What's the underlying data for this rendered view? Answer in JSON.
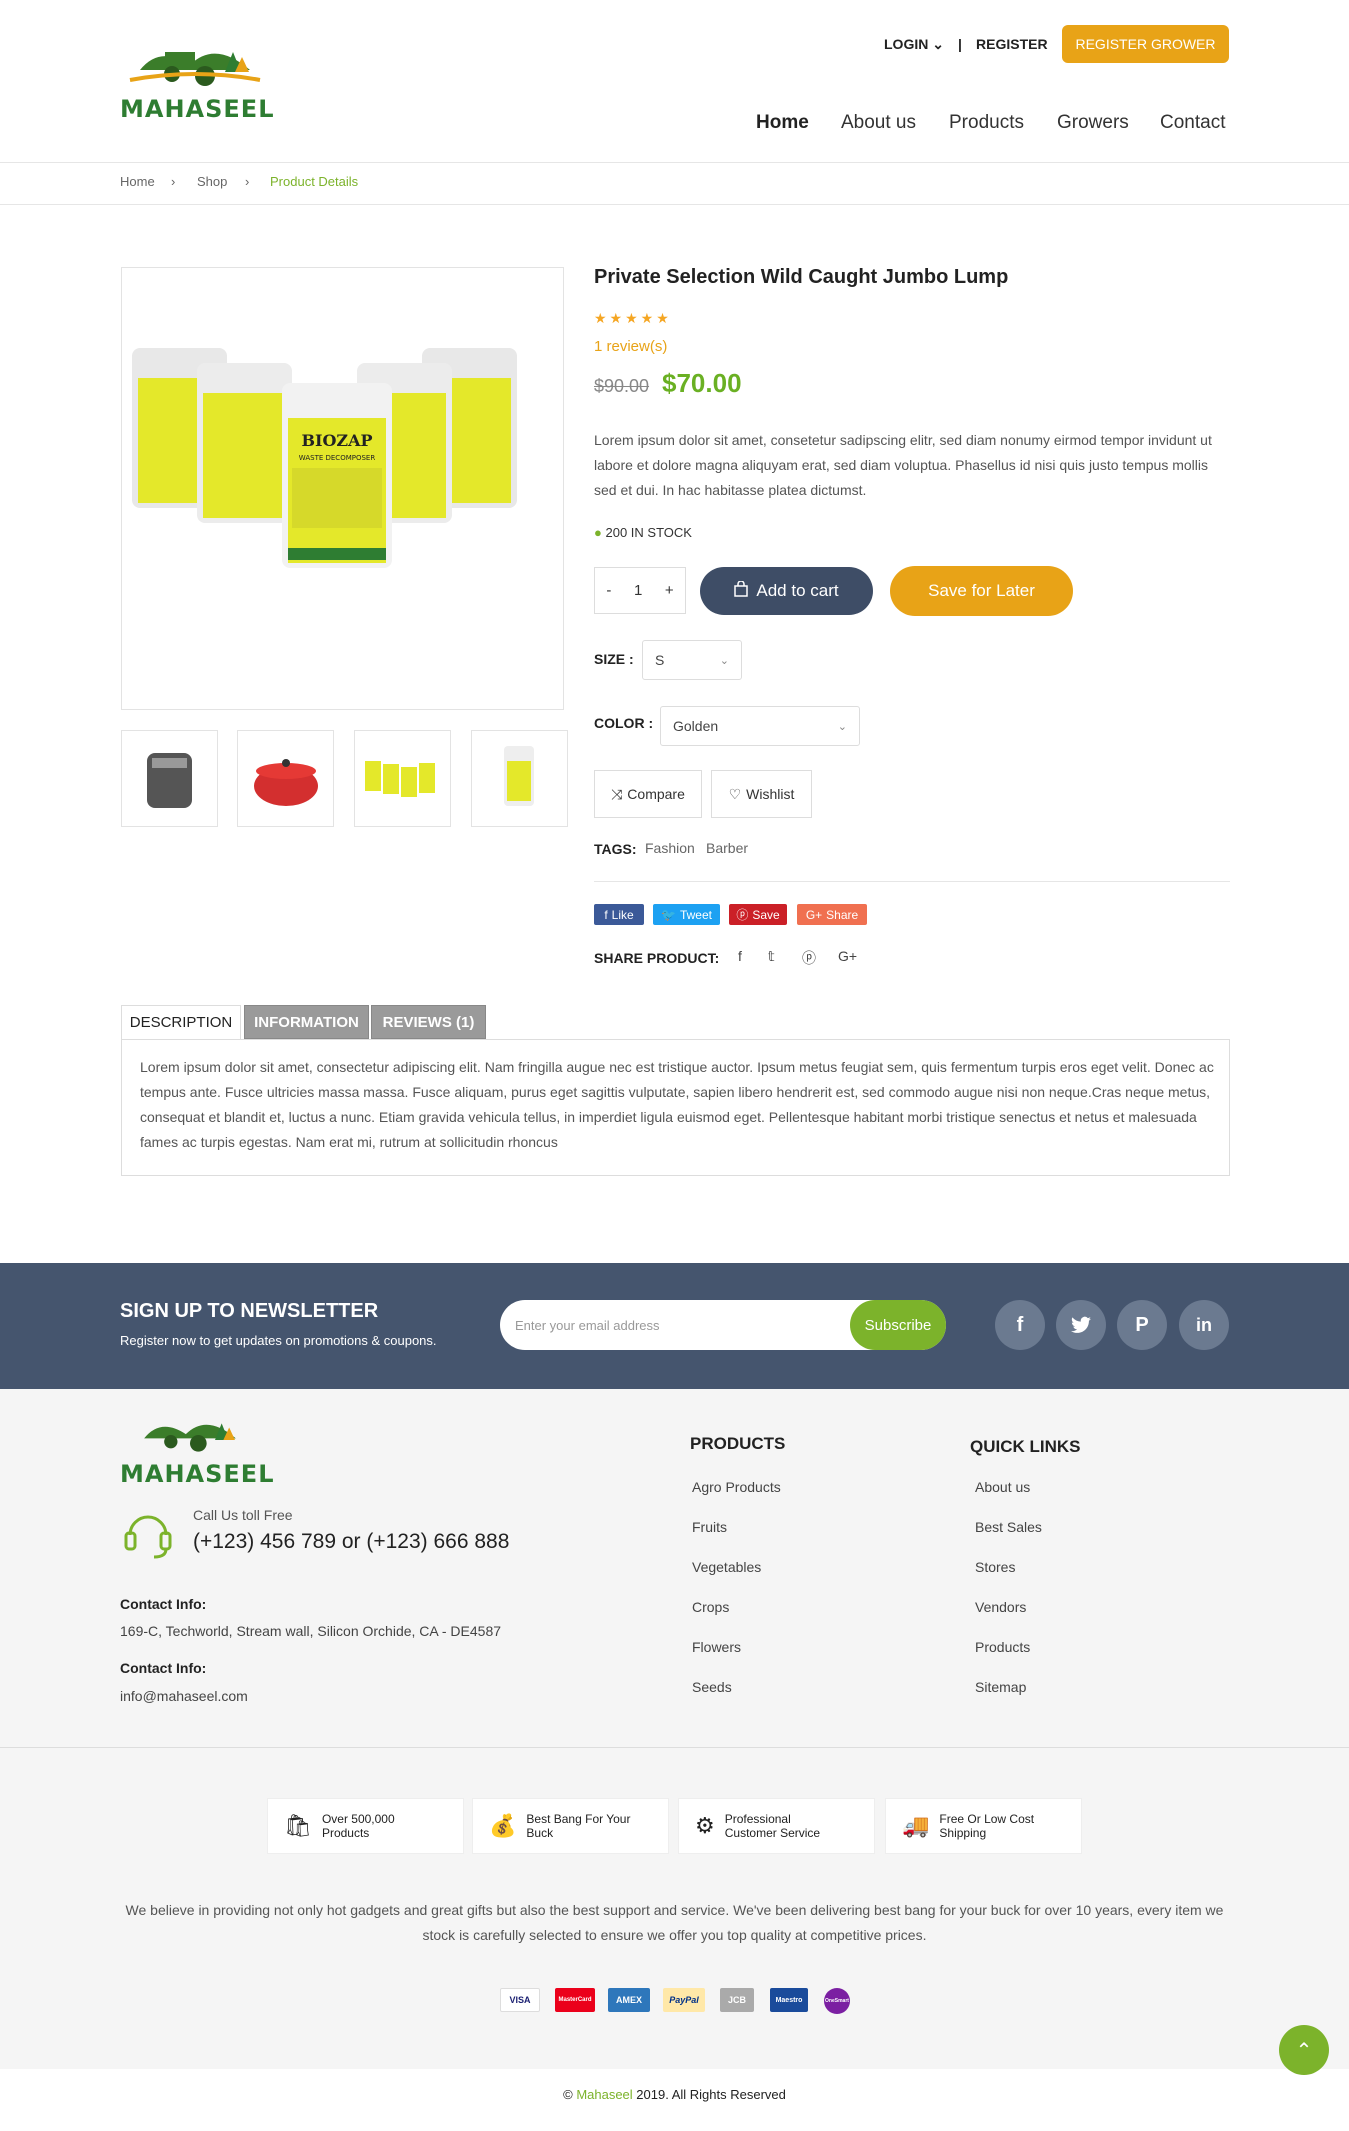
{
  "brand": {
    "name": "MAHASEEL",
    "primary": "#7cb32b",
    "accent": "#e8a317",
    "dark": "#45556e"
  },
  "header": {
    "login": "LOGIN",
    "register": "REGISTER",
    "register_grower": "REGISTER GROWER",
    "nav": [
      "Home",
      "About us",
      "Products",
      "Growers",
      "Contact"
    ]
  },
  "breadcrumb": [
    "Home",
    "Shop",
    "Product Details"
  ],
  "product": {
    "title": "Private Selection Wild Caught Jumbo Lump",
    "rating": 5,
    "reviews": "1 review(s)",
    "old_price": "$90.00",
    "price": "$70.00",
    "description": "Lorem ipsum dolor sit amet, consetetur sadipscing elitr, sed diam nonumy eirmod tempor invidunt ut labore et dolore magna aliquyam erat, sed diam voluptua. Phasellus id nisi quis justo tempus mollis sed et dui. In hac habitasse platea dictumst.",
    "stock": "200 IN STOCK",
    "qty": "1",
    "qty_minus": "-",
    "qty_plus": "+",
    "add_to_cart": "Add to cart",
    "save_later": "Save for Later",
    "size_label": "SIZE :",
    "size_value": "S",
    "color_label": "COLOR :",
    "color_value": "Golden",
    "compare": "Compare",
    "wishlist": "Wishlist",
    "tags_label": "TAGS:",
    "tags": [
      "Fashion",
      "Barber"
    ],
    "share_buttons": [
      "Like",
      "Tweet",
      "Save",
      "Share"
    ],
    "share_label": "SHARE PRODUCT:",
    "main_image_text": "BIOZAP",
    "main_image_sub": "WASTE DECOMPOSER"
  },
  "tabs": {
    "items": [
      "DESCRIPTION",
      "INFORMATION",
      "REVIEWS (1)"
    ],
    "content": "Lorem ipsum dolor sit amet, consectetur adipiscing elit. Nam fringilla augue nec est tristique auctor. Ipsum metus feugiat sem, quis fermentum turpis eros eget velit. Donec ac tempus ante. Fusce ultricies massa massa. Fusce aliquam, purus eget sagittis vulputate, sapien libero hendrerit est, sed commodo augue nisi non neque.Cras neque metus, consequat et blandit et, luctus a nunc. Etiam gravida vehicula tellus, in imperdiet ligula euismod eget. Pellentesque habitant morbi tristique senectus et netus et malesuada fames ac turpis egestas. Nam erat mi, rutrum at sollicitudin rhoncus"
  },
  "newsletter": {
    "title": "SIGN UP TO NEWSLETTER",
    "subtitle": "Register now to get updates on promotions & coupons.",
    "placeholder": "Enter your email address",
    "subscribe": "Subscribe"
  },
  "footer": {
    "call_label": "Call Us toll Free",
    "phone": "(+123) 456 789 or (+123) 666 888",
    "contact_title_1": "Contact Info:",
    "address": "169-C, Techworld, Stream wall, Silicon Orchide, CA - DE4587",
    "contact_title_2": "Contact Info:",
    "email": "info@mahaseel.com",
    "products_title": "PRODUCTS",
    "products": [
      "Agro Products",
      "Fruits",
      "Vegetables",
      "Crops",
      "Flowers",
      "Seeds"
    ],
    "links_title": "QUICK LINKS",
    "links": [
      "About us",
      "Best Sales",
      "Stores",
      "Vendors",
      "Products",
      "Sitemap"
    ],
    "features": [
      [
        "Over 500,000",
        "Products"
      ],
      [
        "Best Bang For Your",
        "Buck"
      ],
      [
        "Professional",
        "Customer Service"
      ],
      [
        "Free Or Low Cost",
        "Shipping"
      ]
    ],
    "about": "We believe in providing not only hot gadgets and great gifts but also the best support and service. We've been delivering best bang for your buck for over 10 years, every item we stock is carefully selected to ensure we offer you top quality at competitive prices.",
    "payments": [
      "VISA",
      "MasterCard",
      "AMEX",
      "PayPal",
      "JCB",
      "Maestro",
      "OneSmart"
    ],
    "copyright_prefix": "© ",
    "copyright_brand": "Mahaseel",
    "copyright_suffix": " 2019. All Rights Reserved"
  }
}
